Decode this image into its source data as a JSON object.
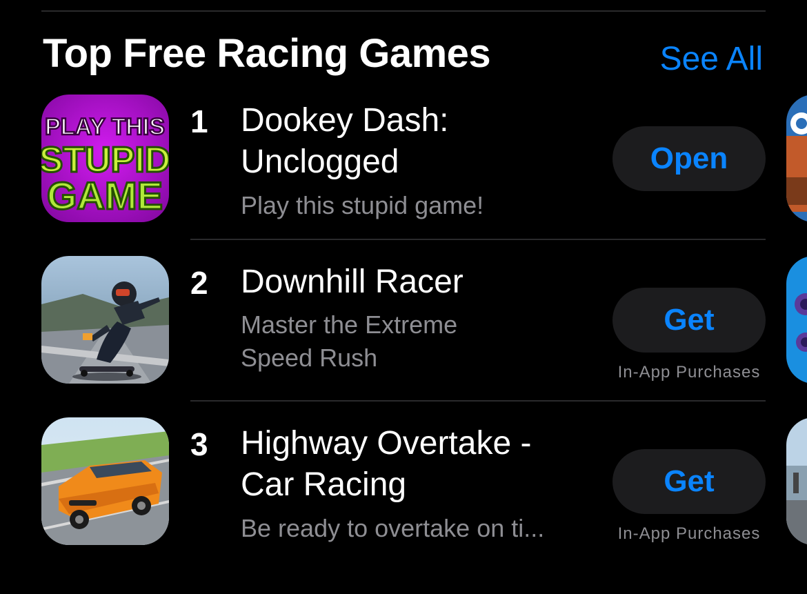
{
  "section": {
    "title": "Top Free Racing Games",
    "see_all_label": "See All"
  },
  "apps": [
    {
      "rank": "1",
      "name": "Dookey Dash: Unclogged",
      "subtitle": "Play this stupid game!",
      "action_label": "Open",
      "in_app_purchases": "",
      "icon_text": [
        "PLAY THIS",
        "STUPID",
        "GAME"
      ]
    },
    {
      "rank": "2",
      "name": "Downhill Racer",
      "subtitle": "Master the Extreme Speed Rush",
      "action_label": "Get",
      "in_app_purchases": "In-App Purchases"
    },
    {
      "rank": "3",
      "name": "Highway Overtake - Car Racing",
      "subtitle": "Be ready to overtake on ti...",
      "action_label": "Get",
      "in_app_purchases": "In-App Purchases"
    }
  ],
  "colors": {
    "accent": "#0a84ff",
    "background": "#000000",
    "button_bg": "#1c1c1e",
    "secondary_text": "#8e8e93"
  }
}
